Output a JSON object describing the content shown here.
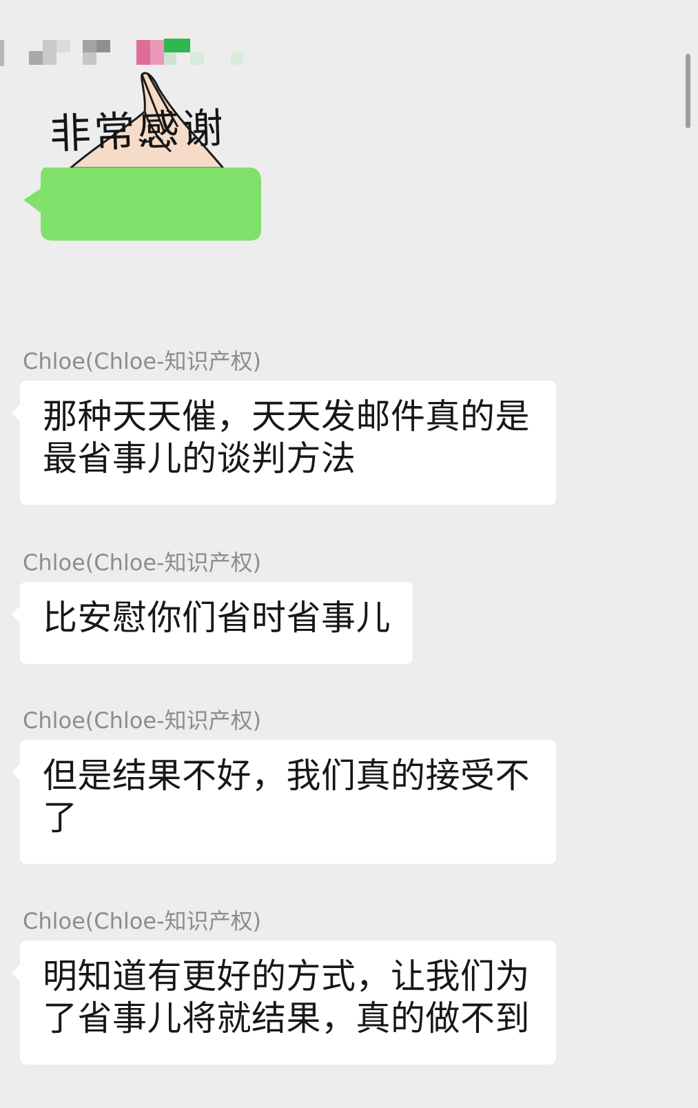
{
  "sticker": {
    "caption": "非常感谢",
    "bubble_color": "#7fe06a"
  },
  "messages": [
    {
      "sender": "Chloe(Chloe-知识产权)",
      "text": "那种天天催，天天发邮件真的是\n最省事儿的谈判方法"
    },
    {
      "sender": "Chloe(Chloe-知识产权)",
      "text": "比安慰你们省时省事儿"
    },
    {
      "sender": "Chloe(Chloe-知识产权)",
      "text": "但是结果不好，我们真的接受不\n了"
    },
    {
      "sender": "Chloe(Chloe-知识产权)",
      "text": "明知道有更好的方式，让我们为\n了省事儿将就结果，真的做不到"
    }
  ],
  "colors": {
    "background": "#ededed",
    "bubble": "#ffffff",
    "sender_name": "#8c8c8c",
    "message_text": "#171717"
  }
}
